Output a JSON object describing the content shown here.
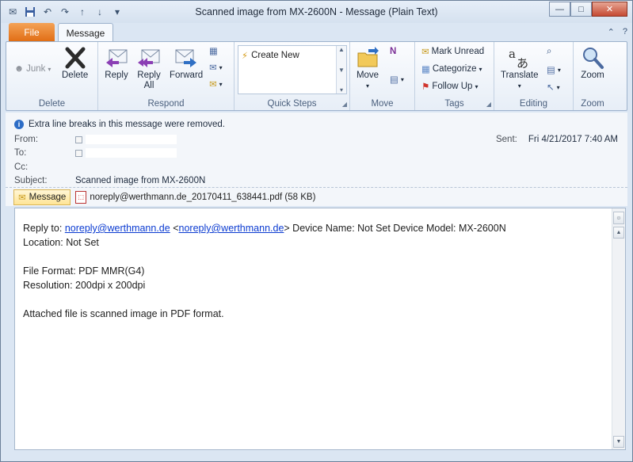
{
  "window": {
    "title": "Scanned image from MX-2600N  -  Message (Plain Text)",
    "minimize": "—",
    "maximize": "□",
    "close": "✕"
  },
  "tabs": {
    "file": "File",
    "message": "Message"
  },
  "ribbon": {
    "delete_group": {
      "label": "Delete",
      "junk": "Junk",
      "delete": "Delete"
    },
    "respond_group": {
      "label": "Respond",
      "reply": "Reply",
      "reply_all_line1": "Reply",
      "reply_all_line2": "All",
      "forward": "Forward"
    },
    "quick_steps_group": {
      "label": "Quick Steps",
      "create_new": "Create New"
    },
    "move_group": {
      "label": "Move",
      "move": "Move"
    },
    "tags_group": {
      "label": "Tags",
      "mark_unread": "Mark Unread",
      "categorize": "Categorize",
      "follow_up": "Follow Up"
    },
    "editing_group": {
      "label": "Editing",
      "translate": "Translate"
    },
    "zoom_group": {
      "label": "Zoom",
      "zoom": "Zoom"
    }
  },
  "header": {
    "info": "Extra line breaks in this message were removed.",
    "from_label": "From:",
    "to_label": "To:",
    "cc_label": "Cc:",
    "subject_label": "Subject:",
    "subject": "Scanned image from MX-2600N",
    "sent_label": "Sent:",
    "sent": "Fri 4/21/2017 7:40 AM"
  },
  "attachments": {
    "message_tab": "Message",
    "file": "noreply@werthmann.de_20170411_638441.pdf (58 KB)"
  },
  "body": {
    "reply_to_prefix": "Reply to: ",
    "reply_to_link1": "noreply@werthmann.de",
    "lt": " <",
    "reply_to_link2": "noreply@werthmann.de",
    "gt_rest": "> Device Name: Not Set Device Model: MX-2600N",
    "location": "Location: Not Set",
    "file_format": "File Format: PDF MMR(G4)",
    "resolution": "Resolution: 200dpi x 200dpi",
    "attached": "Attached file is scanned image in PDF format."
  }
}
